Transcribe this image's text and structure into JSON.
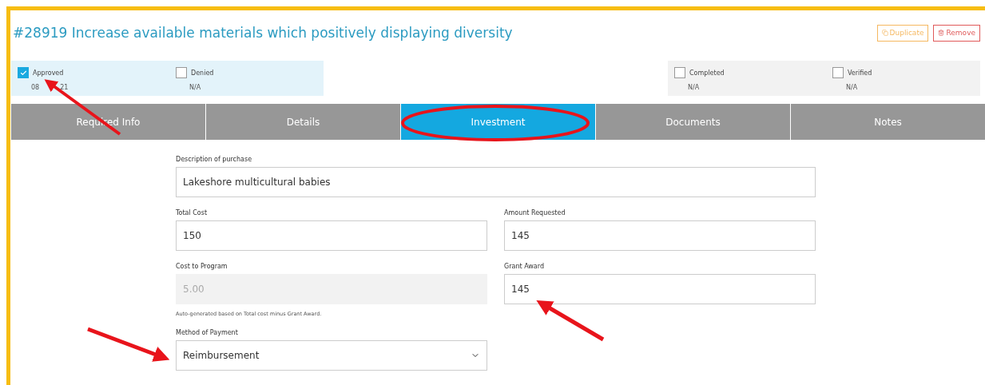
{
  "title": "#28919 Increase available materials which positively displaying diversity",
  "actions": [
    {
      "kind": "duplicate",
      "label": "Duplicate"
    },
    {
      "kind": "remove",
      "label": "Remove"
    }
  ],
  "status_groups": [
    {
      "kind": "decision",
      "items": [
        {
          "label": "Approved",
          "checked": true,
          "date_parts": [
            "08",
            "21"
          ]
        },
        {
          "label": "Denied",
          "checked": false,
          "date_parts": [
            "N/A"
          ]
        }
      ]
    },
    {
      "kind": "progress",
      "items": [
        {
          "label": "Completed",
          "checked": false,
          "date_parts": [
            "N/A"
          ]
        },
        {
          "label": "Verified",
          "checked": false,
          "date_parts": [
            "N/A"
          ]
        }
      ]
    }
  ],
  "tabs": [
    {
      "label": "Required Info",
      "selected": false
    },
    {
      "label": "Details",
      "selected": false
    },
    {
      "label": "Investment",
      "selected": true
    },
    {
      "label": "Documents",
      "selected": false
    },
    {
      "label": "Notes",
      "selected": false
    }
  ],
  "form": {
    "description": {
      "label": "Description of purchase",
      "value": "Lakeshore multicultural babies"
    },
    "total_cost": {
      "label": "Total Cost",
      "value": "150"
    },
    "amount_requested": {
      "label": "Amount Requested",
      "value": "145"
    },
    "cost_to_program": {
      "label": "Cost to Program",
      "value": "5.00",
      "disabled": true,
      "help": "Auto-generated based on Total cost minus Grant Award."
    },
    "grant_award": {
      "label": "Grant Award",
      "value": "145"
    },
    "payment_method": {
      "label": "Method of Payment",
      "value": "Reimbursement"
    }
  }
}
